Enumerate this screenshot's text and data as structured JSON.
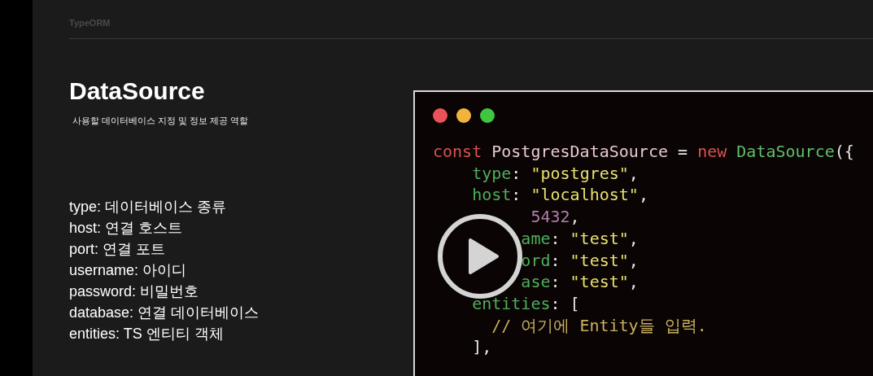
{
  "slide": {
    "header": "TypeORM",
    "title": "DataSource",
    "subtitle": "사용할 데이터베이스 지정 및 정보 제공 역할",
    "items": [
      "type: 데이터베이스 종류",
      "host: 연결 호스트",
      "port: 연결 포트",
      "username: 아이디",
      "password: 비밀번호",
      "database: 연결 데이터베이스",
      "entities: TS 엔티티 객체"
    ]
  },
  "code_window": {
    "lines": [
      [
        {
          "kind": "keyword",
          "text": "const "
        },
        {
          "kind": "name",
          "text": "PostgresDataSource "
        },
        {
          "kind": "punct",
          "text": "= "
        },
        {
          "kind": "keyword",
          "text": "new "
        },
        {
          "kind": "class",
          "text": "DataSource"
        },
        {
          "kind": "punct",
          "text": "({"
        }
      ],
      [
        {
          "kind": "prop",
          "text": "    type"
        },
        {
          "kind": "punct",
          "text": ": "
        },
        {
          "kind": "string",
          "text": "\"postgres\""
        },
        {
          "kind": "punct",
          "text": ","
        }
      ],
      [
        {
          "kind": "prop",
          "text": "    host"
        },
        {
          "kind": "punct",
          "text": ": "
        },
        {
          "kind": "string",
          "text": "\"localhost\""
        },
        {
          "kind": "punct",
          "text": ","
        }
      ],
      [
        {
          "kind": "number",
          "text": "          5432"
        },
        {
          "kind": "punct",
          "text": ","
        }
      ],
      [
        {
          "kind": "prop",
          "text": "         ame"
        },
        {
          "kind": "punct",
          "text": ": "
        },
        {
          "kind": "string",
          "text": "\"test\""
        },
        {
          "kind": "punct",
          "text": ","
        }
      ],
      [
        {
          "kind": "prop",
          "text": "         ord"
        },
        {
          "kind": "punct",
          "text": ": "
        },
        {
          "kind": "string",
          "text": "\"test\""
        },
        {
          "kind": "punct",
          "text": ","
        }
      ],
      [
        {
          "kind": "prop",
          "text": "         ase"
        },
        {
          "kind": "punct",
          "text": ": "
        },
        {
          "kind": "string",
          "text": "\"test\""
        },
        {
          "kind": "punct",
          "text": ","
        }
      ],
      [
        {
          "kind": "prop",
          "text": "    entities"
        },
        {
          "kind": "punct",
          "text": ": ["
        }
      ],
      [
        {
          "kind": "comment",
          "text": "      // 여기에 Entity들 입력."
        }
      ],
      [
        {
          "kind": "punct",
          "text": "    ],"
        }
      ]
    ]
  }
}
